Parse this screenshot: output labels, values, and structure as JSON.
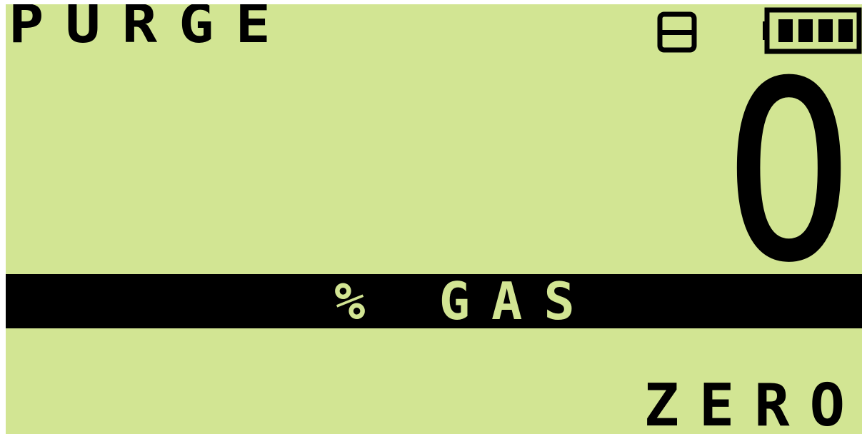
{
  "display": {
    "mode": "PURGE",
    "reading": "0",
    "unit": "% GAS",
    "action": "ZERO",
    "background_color": "#d2e593",
    "foreground_color": "#000000"
  },
  "status": {
    "channel_icon": "channel-indicator-icon",
    "battery_icon": "battery-icon",
    "battery_level": 1.0
  }
}
